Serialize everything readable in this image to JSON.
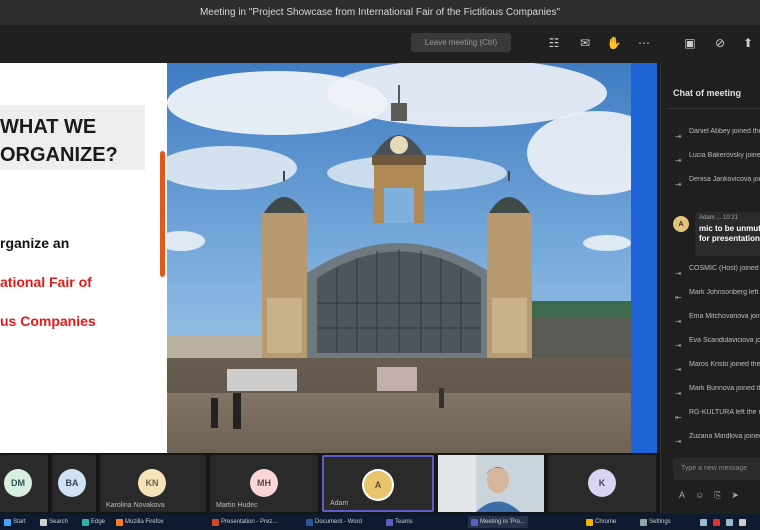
{
  "window": {
    "title": "Meeting in \"Project Showcase from International Fair of the Fictitious Companies\""
  },
  "toolbar": {
    "search_placeholder": "Leave meeting (Ctrl)",
    "icons": [
      "people-icon",
      "chat-icon",
      "raise-hand-icon",
      "more-icon",
      "camera-off-icon",
      "mic-off-icon",
      "share-icon"
    ]
  },
  "slide": {
    "heading": "WHAT WE\nORGANIZE?",
    "line1": "rganize an",
    "line2": "ational Fair of",
    "line3": "us Companies"
  },
  "chat": {
    "title": "Chat of meeting",
    "items": [
      {
        "text": "Daniel Abbey joined the meeting."
      },
      {
        "text": "Lucia Bakerovsky joined the meeting."
      },
      {
        "text": "Denisa Jankovicova joined the meeting."
      }
    ],
    "message": {
      "sender": "Adam ... 10:21",
      "text": "mic to be unmuted\nfor presentation"
    },
    "items2": [
      {
        "text": "COSMIC (Host) joined the meeting."
      },
      {
        "text": "Mark Johnsonberg left the meeting."
      },
      {
        "text": "Ema Mitchovanova joined the meeting."
      },
      {
        "text": "Eva Scandulaviciova joined the meeting."
      },
      {
        "text": "Maros Kristo joined the meeting."
      },
      {
        "text": "Mark Bunnova joined the meeting."
      },
      {
        "text": "RG-KULTURA left the meeting."
      },
      {
        "text": "Zuzana Mindlova joined the meeting."
      }
    ],
    "input_placeholder": "Type a new message"
  },
  "participants": [
    {
      "initials": "DM",
      "name": "",
      "color": "#d8efe0"
    },
    {
      "initials": "BA",
      "name": "",
      "color": "#cfe3f2"
    },
    {
      "initials": "KN",
      "name": "Karolina Novakova",
      "color": "#f3e3b7"
    },
    {
      "initials": "MH",
      "name": "Martin Hudec",
      "color": "#f7d7d7"
    },
    {
      "initials": "A",
      "name": "Adam",
      "color": "#e8c46c"
    },
    {
      "initials": "",
      "name": "",
      "color": "#7aa6c9"
    },
    {
      "initials": "K",
      "name": "",
      "color": "#d9d4f4"
    }
  ],
  "taskbar": {
    "items": [
      "Start",
      "Search",
      "Edge",
      "Mozilla Firefox",
      "Presentation - Prez...",
      "Document - Word",
      "Teams",
      "Meeting in 'Pro...",
      "Chrome",
      "Settings"
    ]
  }
}
